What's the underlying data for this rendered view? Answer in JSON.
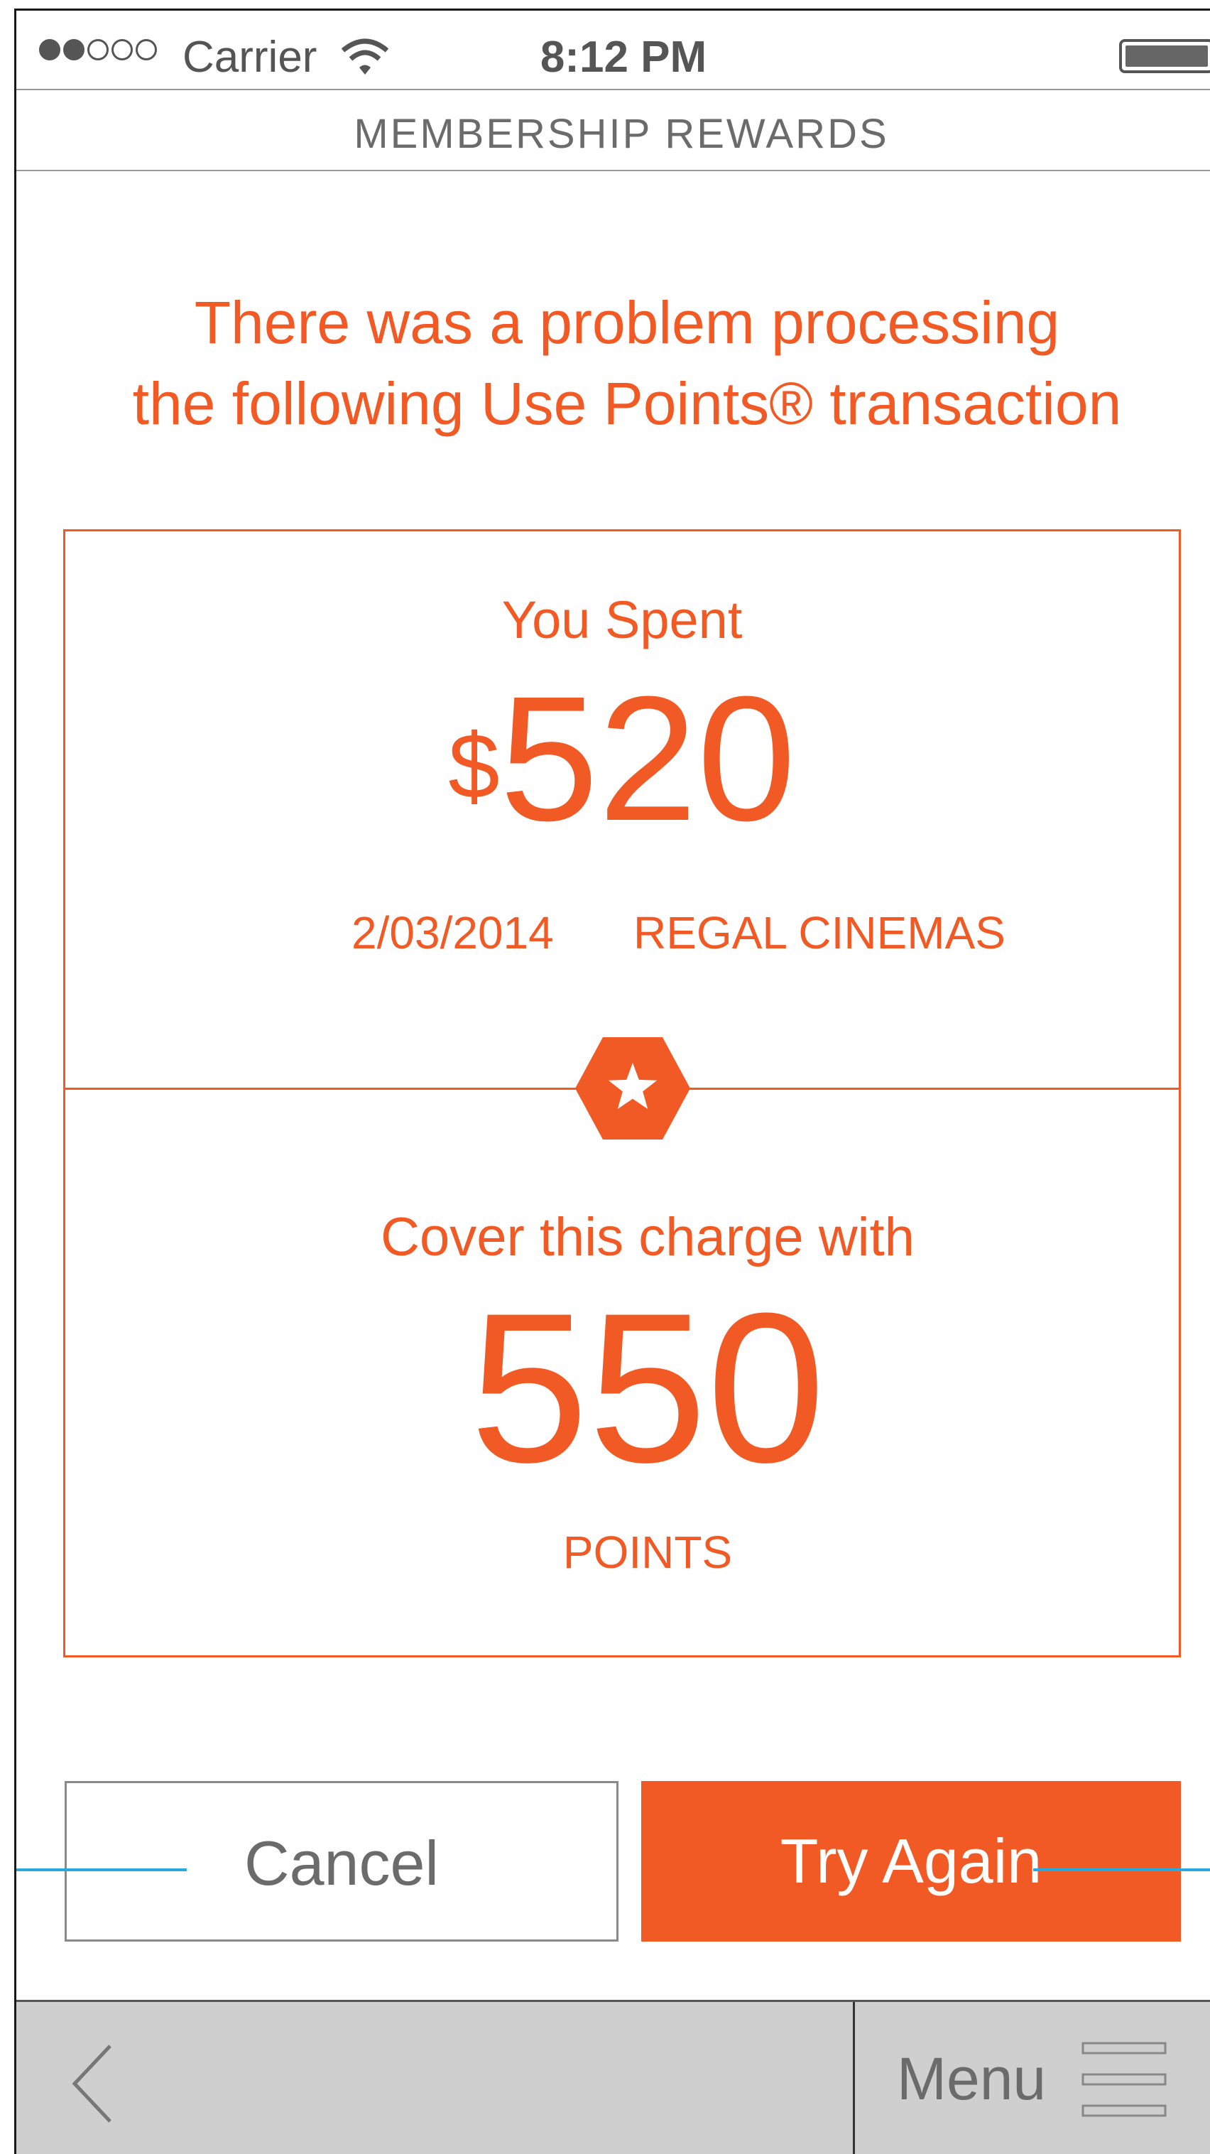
{
  "status_bar": {
    "carrier": "Carrier",
    "time": "8:12 PM",
    "signal_bars_filled": 2,
    "signal_bars_total": 5
  },
  "header": {
    "title": "MEMBERSHIP REWARDS"
  },
  "error": {
    "line1": "There was a problem processing",
    "line2": "the following Use Points® transaction"
  },
  "transaction": {
    "spent_label": "You Spent",
    "currency": "$",
    "amount": "520",
    "date": "2/03/2014",
    "merchant": "REGAL CINEMAS"
  },
  "cover": {
    "label": "Cover this charge with",
    "points": "550",
    "unit": "POINTS"
  },
  "buttons": {
    "cancel": "Cancel",
    "try_again": "Try Again"
  },
  "bottom_bar": {
    "menu_label": "Menu"
  },
  "colors": {
    "accent": "#f15a24",
    "annotation": "#2aa8e0",
    "bar": "#cfcfcf"
  }
}
